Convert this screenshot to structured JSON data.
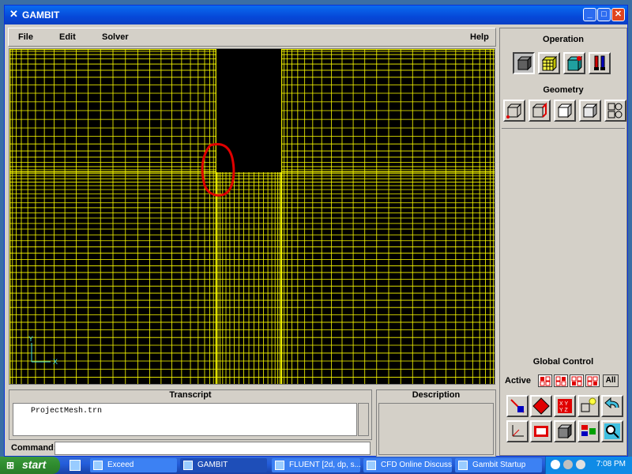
{
  "window": {
    "title": "GAMBIT"
  },
  "menu": {
    "file": "File",
    "edit": "Edit",
    "solver": "Solver",
    "help": "Help"
  },
  "axes": {
    "y": "Y",
    "x": "X"
  },
  "panel": {
    "operation_title": "Operation",
    "operation_tools": [
      "geometry-tool",
      "mesh-tool",
      "zones-tool",
      "tools-tool"
    ],
    "geometry_title": "Geometry",
    "geometry_tools": [
      "vertex-tool",
      "edge-tool",
      "face-tool",
      "volume-tool",
      "group-tool"
    ],
    "global_title": "Global Control",
    "active_label": "Active",
    "all_label": "All"
  },
  "transcript": {
    "title": "Transcript",
    "line": "ProjectMesh.trn"
  },
  "description": {
    "title": "Description"
  },
  "command": {
    "label": "Command:",
    "value": ""
  },
  "taskbar": {
    "start": "start",
    "tasks": [
      "Exceed",
      "GAMBIT",
      "FLUENT [2d, dp, s...",
      "CFD Online Discuss...",
      "Gambit Startup"
    ],
    "clock": "7:08 PM"
  },
  "colors": {
    "mesh": "#ffff00",
    "grid_background": "#000000",
    "annotation": "#e00000",
    "titlebar": "#0648d8"
  }
}
